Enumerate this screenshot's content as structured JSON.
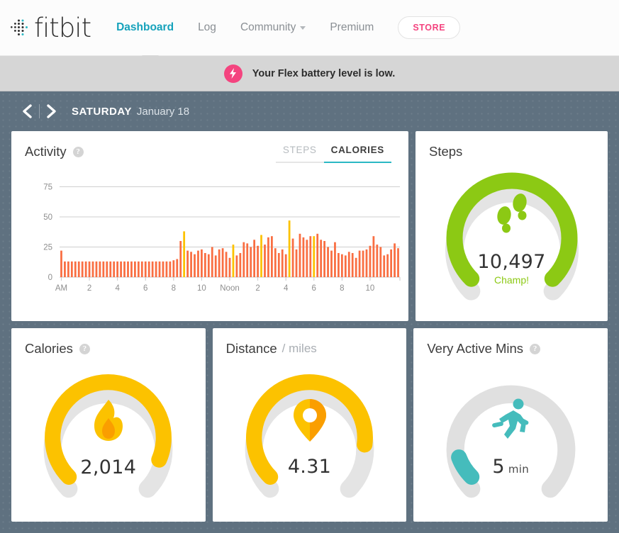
{
  "nav": {
    "logo_text": "fitbit",
    "logo_icon": "fitbit-dot-logo",
    "items": [
      {
        "label": "Dashboard",
        "active": true
      },
      {
        "label": "Log",
        "active": false
      },
      {
        "label": "Community",
        "active": false,
        "has_dropdown": true
      },
      {
        "label": "Premium",
        "active": false
      }
    ],
    "store_label": "STORE",
    "store_color": "#f4447f",
    "active_color": "#15a2bb"
  },
  "alert": {
    "icon": "lightning-bolt-icon",
    "badge_color": "#f4447f",
    "message": "Your Flex battery level is low."
  },
  "datebar": {
    "prev_icon": "chevron-left-icon",
    "next_icon": "chevron-right-icon",
    "weekday": "SATURDAY",
    "date": "January 18"
  },
  "activity": {
    "title": "Activity",
    "help_icon": "question-mark-icon",
    "tabs": [
      {
        "label": "STEPS",
        "active": false
      },
      {
        "label": "CALORIES",
        "active": true
      }
    ]
  },
  "chart_data": {
    "type": "bar",
    "title": "Activity",
    "xlabel": "",
    "ylabel": "",
    "ylim": [
      0,
      80
    ],
    "yticks": [
      0,
      25,
      50,
      75
    ],
    "grid": true,
    "bar_color": "#f96e42",
    "highlight_color": "#fcc200",
    "xtick_labels": [
      "AM",
      "2",
      "4",
      "6",
      "8",
      "10",
      "Noon",
      "2",
      "4",
      "6",
      "8",
      "10"
    ],
    "xtick_positions": [
      0,
      8,
      16,
      24,
      32,
      40,
      48,
      56,
      64,
      72,
      80,
      88
    ],
    "values": [
      22,
      13,
      13,
      13,
      13,
      13,
      13,
      13,
      13,
      13,
      13,
      13,
      13,
      13,
      13,
      13,
      13,
      13,
      13,
      13,
      13,
      13,
      13,
      13,
      13,
      13,
      13,
      13,
      13,
      13,
      13,
      13,
      14,
      15,
      30,
      38,
      22,
      21,
      19,
      22,
      23,
      20,
      19,
      25,
      18,
      23,
      24,
      21,
      16,
      27,
      18,
      20,
      29,
      28,
      25,
      31,
      26,
      35,
      27,
      33,
      34,
      24,
      20,
      23,
      19,
      47,
      32,
      23,
      36,
      33,
      31,
      34,
      34,
      36,
      31,
      30,
      25,
      22,
      29,
      20,
      19,
      18,
      21,
      20,
      16,
      22,
      22,
      23,
      26,
      34,
      27,
      25,
      18,
      19,
      23,
      28,
      24
    ],
    "highlight_indices": [
      35,
      49,
      57,
      65,
      72
    ],
    "n_bars": 97
  },
  "steps": {
    "title": "Steps",
    "icon": "footprints-icon",
    "value": "10,497",
    "caption": "Champ!",
    "progress": 1.0,
    "color": "#8cc914",
    "track_color": "#e4e4e4"
  },
  "calories": {
    "title": "Calories",
    "help_icon": "question-mark-icon",
    "icon": "flame-icon",
    "value": "2,014",
    "progress": 0.92,
    "color": "#fcc200",
    "track_color": "#e4e4e4"
  },
  "distance": {
    "title": "Distance",
    "subtitle": "/ miles",
    "icon": "map-pin-icon",
    "value": "4.31",
    "progress": 0.86,
    "color": "#fcc200",
    "track_color": "#e4e4e4"
  },
  "very_active": {
    "title": "Very Active Mins",
    "help_icon": "question-mark-icon",
    "icon": "runner-icon",
    "value": "5",
    "unit": "min",
    "progress": 0.09,
    "color": "#45bcbc",
    "track_color": "#e0e0e0"
  }
}
